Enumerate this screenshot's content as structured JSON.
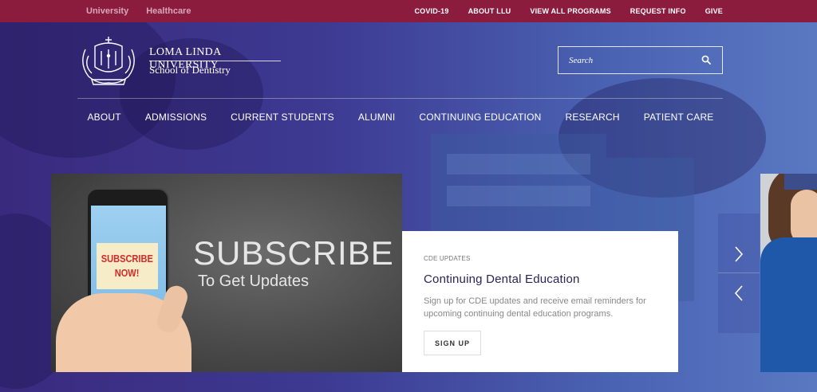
{
  "topbar": {
    "left_links": [
      "University",
      "Healthcare"
    ],
    "right_links": [
      "COVID-19",
      "ABOUT LLU",
      "VIEW ALL PROGRAMS",
      "REQUEST INFO",
      "GIVE"
    ]
  },
  "logo": {
    "university": "LOMA LINDA UNIVERSITY",
    "school": "School of Dentistry"
  },
  "search": {
    "placeholder": "Search",
    "icon": "search-icon"
  },
  "nav": {
    "items": [
      "ABOUT",
      "ADMISSIONS",
      "CURRENT STUDENTS",
      "ALUMNI",
      "CONTINUING EDUCATION",
      "RESEARCH",
      "PATIENT CARE"
    ]
  },
  "slide": {
    "image": {
      "sticky_line1": "SUBSCRIBE",
      "sticky_line2": "NOW!",
      "headline": "SUBSCRIBE",
      "subline": "To Get Updates"
    },
    "card": {
      "category": "CDE UPDATES",
      "title": "Continuing Dental Education",
      "description": "Sign up for CDE updates and receive email reminders for upcoming continuing dental education programs.",
      "button_label": "SIGN UP"
    }
  },
  "carousel": {
    "next_icon": "chevron-right-icon",
    "prev_icon": "chevron-left-icon"
  },
  "colors": {
    "topbar": "#8b1c3e",
    "hero": "#3d3a92",
    "card_title": "#2b2358"
  }
}
